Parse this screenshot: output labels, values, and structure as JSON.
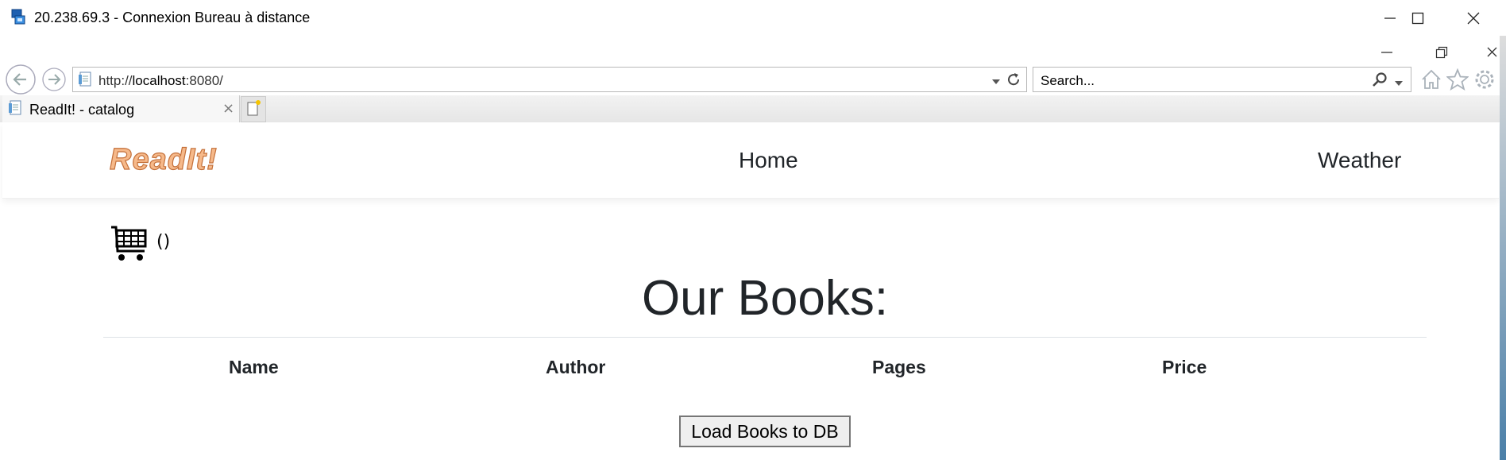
{
  "rdp": {
    "title": "20.238.69.3 - Connexion Bureau à distance"
  },
  "browser": {
    "address_prefix": "http://",
    "address_host": "localhost",
    "address_suffix": ":8080/",
    "search_placeholder": "Search...",
    "tab_label": "ReadIt! - catalog",
    "tab_close": "×"
  },
  "page": {
    "brand": "ReadIt!",
    "nav": {
      "home": "Home",
      "weather": "Weather"
    },
    "cart_count": "()",
    "title": "Our Books:",
    "columns": [
      "Name",
      "Author",
      "Pages",
      "Price"
    ],
    "load_button": "Load Books to DB"
  },
  "colors": {
    "brand_fill": "#f6b98a",
    "brand_stroke": "#c4703a"
  }
}
